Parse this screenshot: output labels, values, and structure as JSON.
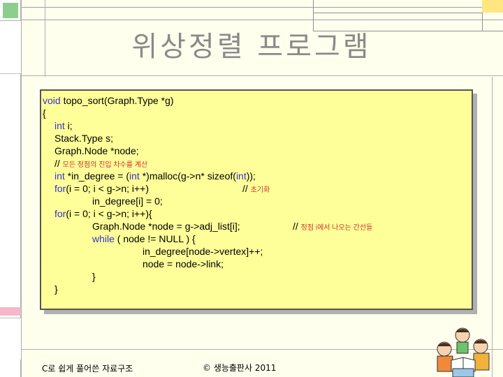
{
  "slide": {
    "title": "위상정렬 프로그램",
    "footer_left": "C로 쉽게 풀어쓴 자료구조",
    "footer_center": "© 생능출판사 2011"
  },
  "code": {
    "l1_kw": "void",
    "l1_rest": " topo_sort(Graph.Type *g)",
    "l2": "{",
    "l3_kw": "int",
    "l3_rest": " i;",
    "l4": "Stack.Type s;",
    "l5": "Graph.Node *node;",
    "l6_slash": "// ",
    "l6_comment": "모든 정점의 진입 차수를 계산",
    "l7_kw1": "int",
    "l7_mid": " *in_degree = (",
    "l7_kw2": "int",
    "l7_mid2": " *)malloc(g->n* sizeof(",
    "l7_kw3": "int",
    "l7_end": "));",
    "l8_kw": "for",
    "l8_rest": "(i = 0; i < g->n; i++)",
    "l8_slash": "// ",
    "l8_comment": "초기화",
    "l9": "in_degree[i] = 0;",
    "l10_kw": "for",
    "l10_rest": "(i = 0; i < g->n; i++){",
    "l11": "Graph.Node *node = g->adj_list[i];",
    "l11_slash": "// ",
    "l11_comment": "정점 i에서 나오는 간선들",
    "l12_kw": "while",
    "l12_rest": " ( node != NULL ) {",
    "l13": "in_degree[node->vertex]++;",
    "l14": "node = node->link;",
    "l15": "}",
    "l16": "}"
  },
  "colors": {
    "keyword": "#3333cc",
    "comment": "#cc3333",
    "panel_bg": "#ffff99",
    "title": "#8a8a8a"
  }
}
